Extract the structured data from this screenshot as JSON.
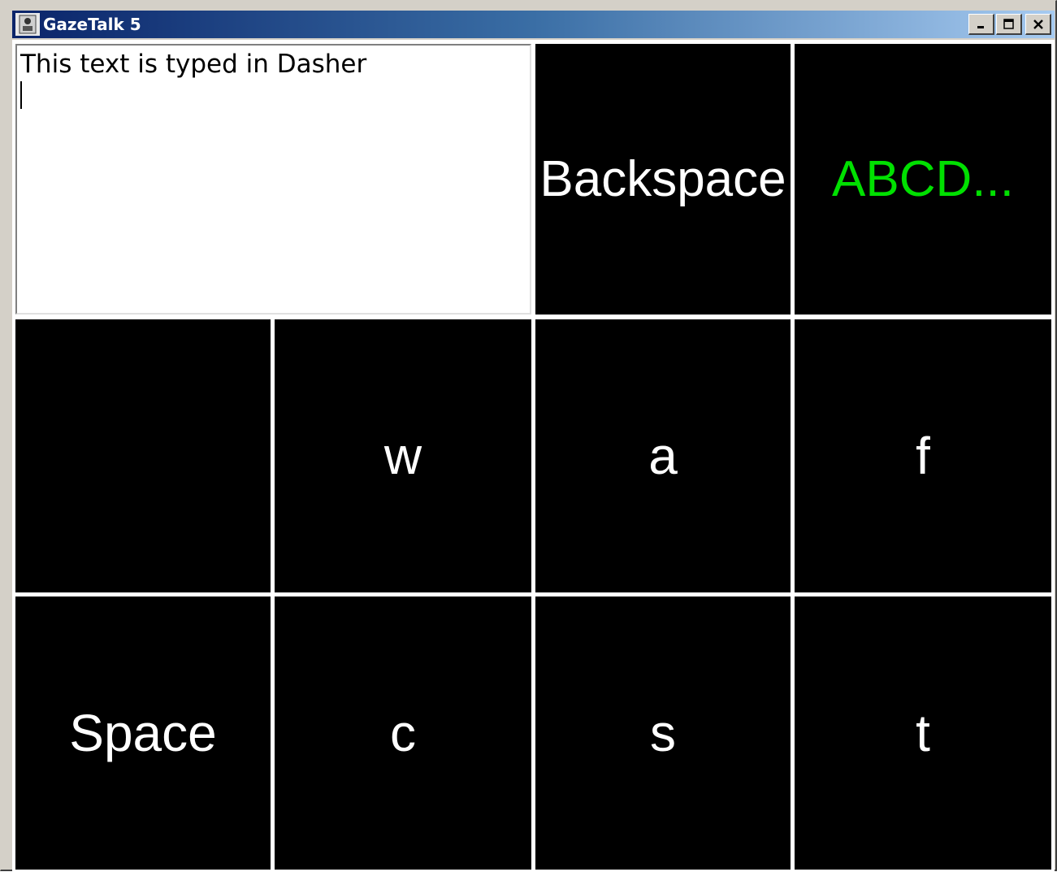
{
  "window": {
    "title": "GazeTalk 5",
    "controls": {
      "minimize": "minimize-icon",
      "maximize": "maximize-icon",
      "close": "close-icon"
    }
  },
  "text_area": {
    "value": "This text is typed in Dasher"
  },
  "keys": {
    "backspace": "Backspace",
    "abcd": "ABCD...",
    "blank": "",
    "w": "w",
    "a": "a",
    "f": "f",
    "space": "Space",
    "c": "c",
    "s": "s",
    "t": "t"
  },
  "colors": {
    "key_bg": "#000000",
    "key_text": "#ffffff",
    "abcd_text": "#00e000",
    "titlebar_start": "#0a246a",
    "titlebar_end": "#a6caf0"
  }
}
